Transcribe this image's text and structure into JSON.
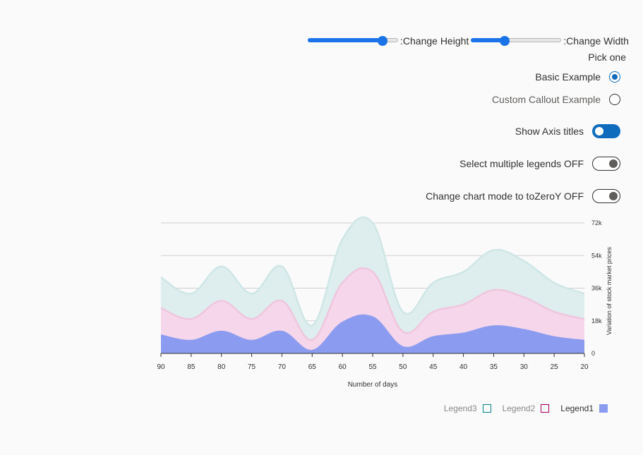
{
  "controls": {
    "height_slider": {
      "label": ":Change Height",
      "value": 0.83
    },
    "width_slider": {
      "label": ":Change Width",
      "value": 0.37
    },
    "pick_one": "Pick one",
    "radios": [
      {
        "label": "Basic Example",
        "checked": true
      },
      {
        "label": "Custom Callout Example",
        "checked": false
      }
    ],
    "toggles": [
      {
        "label": "Show Axis titles",
        "on": true
      },
      {
        "label": "Select multiple legends OFF",
        "on": false
      },
      {
        "label": "Change chart mode to toZeroY OFF",
        "on": false
      }
    ]
  },
  "colors": {
    "legend1": "#8b9cf0",
    "legend2": "#f5d6ea",
    "legend3": "#deeeee",
    "legend1_line": "#8b9cf0",
    "legend2_line": "#efc6de",
    "legend3_line": "#cfe6e6",
    "legend2_border": "#a4005c",
    "legend3_border": "#038387",
    "accent": "#0f6cbd"
  },
  "chart_data": {
    "type": "area",
    "stacked": true,
    "xlabel": "Number of days",
    "ylabel": "Variation of stock market prices",
    "x": [
      90,
      85,
      80,
      75,
      70,
      65,
      60,
      55,
      50,
      45,
      40,
      35,
      30,
      25,
      20
    ],
    "x_ticks": [
      "90",
      "85",
      "80",
      "75",
      "70",
      "65",
      "60",
      "55",
      "50",
      "45",
      "40",
      "35",
      "30",
      "25",
      "20"
    ],
    "y_ticks": [
      "0",
      "18k",
      "36k",
      "54k",
      "72k"
    ],
    "ylim": [
      0,
      72000
    ],
    "x_reversed": true,
    "series": [
      {
        "name": "Legend1",
        "values": [
          10000,
          7000,
          12000,
          7000,
          12000,
          1500,
          17000,
          20000,
          3500,
          9000,
          11000,
          15000,
          13000,
          9000,
          7000
        ]
      },
      {
        "name": "Legend2",
        "values": [
          15000,
          12000,
          17000,
          12000,
          17000,
          6000,
          22000,
          25000,
          8500,
          14000,
          16000,
          20000,
          18000,
          14000,
          12000
        ]
      },
      {
        "name": "Legend3",
        "values": [
          17000,
          14000,
          19000,
          14000,
          19000,
          8000,
          24000,
          27000,
          11000,
          16000,
          18000,
          22000,
          20000,
          16000,
          14000
        ]
      }
    ],
    "legend_position": "bottom-right",
    "grid": true
  },
  "legend": [
    {
      "label": "Legend3",
      "active": false
    },
    {
      "label": "Legend2",
      "active": false
    },
    {
      "label": "Legend1",
      "active": true
    }
  ]
}
